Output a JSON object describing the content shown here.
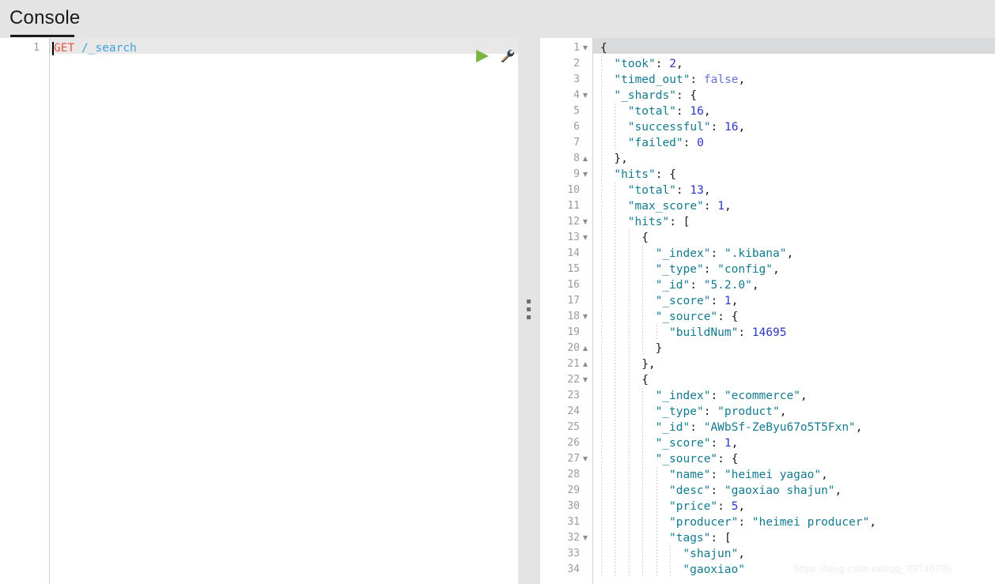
{
  "header": {
    "title": "Console"
  },
  "toolbar": {
    "run_icon": "play-triangle-icon",
    "settings_icon": "wrench-icon",
    "run_color": "#7cb342",
    "wrench_color": "#2e3d4d"
  },
  "request_editor": {
    "line_numbers": [
      "1"
    ],
    "lines": [
      {
        "number": "1",
        "method": "GET",
        "space": " ",
        "path": "/_search"
      }
    ]
  },
  "divider": {
    "handle_icon": "drag-handle-dots-icon"
  },
  "response_editor": {
    "lines": [
      {
        "n": "1",
        "fold": "down",
        "indent": 0,
        "text": "{"
      },
      {
        "n": "2",
        "fold": "",
        "indent": 1,
        "text": "\"took\": 2,"
      },
      {
        "n": "3",
        "fold": "",
        "indent": 1,
        "text": "\"timed_out\": false,"
      },
      {
        "n": "4",
        "fold": "down",
        "indent": 1,
        "text": "\"_shards\": {"
      },
      {
        "n": "5",
        "fold": "",
        "indent": 2,
        "text": "\"total\": 16,"
      },
      {
        "n": "6",
        "fold": "",
        "indent": 2,
        "text": "\"successful\": 16,"
      },
      {
        "n": "7",
        "fold": "",
        "indent": 2,
        "text": "\"failed\": 0"
      },
      {
        "n": "8",
        "fold": "up",
        "indent": 1,
        "text": "},"
      },
      {
        "n": "9",
        "fold": "down",
        "indent": 1,
        "text": "\"hits\": {"
      },
      {
        "n": "10",
        "fold": "",
        "indent": 2,
        "text": "\"total\": 13,"
      },
      {
        "n": "11",
        "fold": "",
        "indent": 2,
        "text": "\"max_score\": 1,"
      },
      {
        "n": "12",
        "fold": "down",
        "indent": 2,
        "text": "\"hits\": ["
      },
      {
        "n": "13",
        "fold": "down",
        "indent": 3,
        "text": "{"
      },
      {
        "n": "14",
        "fold": "",
        "indent": 4,
        "text": "\"_index\": \".kibana\","
      },
      {
        "n": "15",
        "fold": "",
        "indent": 4,
        "text": "\"_type\": \"config\","
      },
      {
        "n": "16",
        "fold": "",
        "indent": 4,
        "text": "\"_id\": \"5.2.0\","
      },
      {
        "n": "17",
        "fold": "",
        "indent": 4,
        "text": "\"_score\": 1,"
      },
      {
        "n": "18",
        "fold": "down",
        "indent": 4,
        "text": "\"_source\": {"
      },
      {
        "n": "19",
        "fold": "",
        "indent": 5,
        "text": "\"buildNum\": 14695"
      },
      {
        "n": "20",
        "fold": "up",
        "indent": 4,
        "text": "}"
      },
      {
        "n": "21",
        "fold": "up",
        "indent": 3,
        "text": "},"
      },
      {
        "n": "22",
        "fold": "down",
        "indent": 3,
        "text": "{"
      },
      {
        "n": "23",
        "fold": "",
        "indent": 4,
        "text": "\"_index\": \"ecommerce\","
      },
      {
        "n": "24",
        "fold": "",
        "indent": 4,
        "text": "\"_type\": \"product\","
      },
      {
        "n": "25",
        "fold": "",
        "indent": 4,
        "text": "\"_id\": \"AWbSf-ZeByu67o5T5Fxn\","
      },
      {
        "n": "26",
        "fold": "",
        "indent": 4,
        "text": "\"_score\": 1,"
      },
      {
        "n": "27",
        "fold": "down",
        "indent": 4,
        "text": "\"_source\": {"
      },
      {
        "n": "28",
        "fold": "",
        "indent": 5,
        "text": "\"name\": \"heimei yagao\","
      },
      {
        "n": "29",
        "fold": "",
        "indent": 5,
        "text": "\"desc\": \"gaoxiao shajun\","
      },
      {
        "n": "30",
        "fold": "",
        "indent": 5,
        "text": "\"price\": 5,"
      },
      {
        "n": "31",
        "fold": "",
        "indent": 5,
        "text": "\"producer\": \"heimei producer\","
      },
      {
        "n": "32",
        "fold": "down",
        "indent": 5,
        "text": "\"tags\": ["
      },
      {
        "n": "33",
        "fold": "",
        "indent": 6,
        "text": "\"shajun\","
      },
      {
        "n": "34",
        "fold": "",
        "indent": 6,
        "text": "\"gaoxiao\""
      }
    ]
  },
  "watermark": {
    "text": "https://blog.csdn.net/qq_33746789"
  }
}
